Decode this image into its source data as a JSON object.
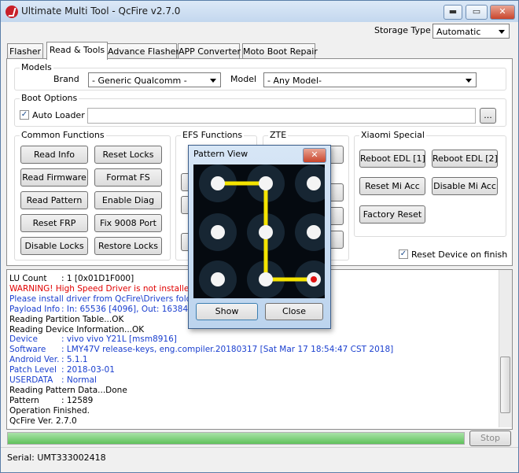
{
  "window": {
    "title": "Ultimate Multi Tool - QcFire v2.7.0",
    "minimize_glyph": "▬",
    "maximize_glyph": "▭",
    "close_glyph": "✕"
  },
  "storage": {
    "label": "Storage Type",
    "value": "Automatic"
  },
  "tabs": [
    "Flasher",
    "Read & Tools",
    "Advance Flasher",
    "APP Converter",
    "Moto Boot Repair"
  ],
  "models": {
    "title": "Models",
    "brand_label": "Brand",
    "brand_value": "- Generic Qualcomm -",
    "model_label": "Model",
    "model_value": "- Any Model-"
  },
  "boot_options": {
    "title": "Boot Options",
    "auto_loader_label": "Auto Loader",
    "auto_loader_checked": true,
    "browse_label": "..."
  },
  "common_functions": {
    "title": "Common Functions",
    "buttons": [
      "Read Info",
      "Reset Locks",
      "Read Firmware",
      "Format FS",
      "Read Pattern",
      "Enable Diag",
      "Reset FRP",
      "Fix 9008 Port",
      "Disable Locks",
      "Restore Locks"
    ]
  },
  "efs": {
    "title": "EFS Functions"
  },
  "zte": {
    "title": "ZTE"
  },
  "xiaomi": {
    "title": "Xiaomi Special",
    "buttons": [
      "Reboot EDL [1]",
      "Reboot EDL [2]",
      "Reset Mi Acc",
      "Disable Mi Acc",
      "Factory Reset"
    ]
  },
  "reset_on_finish": {
    "label": "Reset Device on finish",
    "checked": true
  },
  "log": [
    {
      "key": "LU Count",
      "value": ": 1 [0x01D1F000]",
      "color": "#000000"
    },
    {
      "key": "",
      "value": "WARNING! High Speed Driver is not installed.",
      "color": "#e00000"
    },
    {
      "key": "",
      "value": "Please install driver from QcFire\\Drivers folder u",
      "color": "#1a3fcf"
    },
    {
      "key": "Payload Info",
      "value": ": In: 65536 [4096], Out: 16384, S",
      "color": "#1a3fcf"
    },
    {
      "key": "",
      "value": "Reading Partition Table...OK",
      "color": "#000000"
    },
    {
      "key": "",
      "value": "Reading Device Information...OK",
      "color": "#000000"
    },
    {
      "key": "Device",
      "value": ": vivo vivo Y21L [msm8916]",
      "color": "#1a3fcf"
    },
    {
      "key": "Software",
      "value": ": LMY47V release-keys, eng.compiler.20180317 [Sat Mar 17 18:54:47 CST 2018]",
      "color": "#1a3fcf"
    },
    {
      "key": "Android Ver.",
      "value": ": 5.1.1",
      "color": "#1a3fcf"
    },
    {
      "key": "Patch Level",
      "value": ": 2018-03-01",
      "color": "#1a3fcf"
    },
    {
      "key": "USERDATA",
      "value": ": Normal",
      "color": "#1a3fcf"
    },
    {
      "key": "",
      "value": "Reading Pattern Data...Done",
      "color": "#000000"
    },
    {
      "key": "Pattern",
      "value": ": 12589",
      "color": "#000000"
    },
    {
      "key": "",
      "value": "Operation Finished.",
      "color": "#000000"
    },
    {
      "key": "",
      "value": "QcFire Ver. 2.7.0",
      "color": "#000000"
    }
  ],
  "progress": {
    "value": 1.0
  },
  "stop_label": "Stop",
  "status": {
    "serial": "Serial: UMT333002418"
  },
  "dialog": {
    "title": "Pattern View",
    "close_glyph": "✕",
    "show_label": "Show",
    "close_label": "Close",
    "pattern": "12589"
  },
  "colors": {
    "pattern_line": "#f5e400",
    "pattern_end": "#e01010",
    "dot": "#f4f4f4"
  }
}
